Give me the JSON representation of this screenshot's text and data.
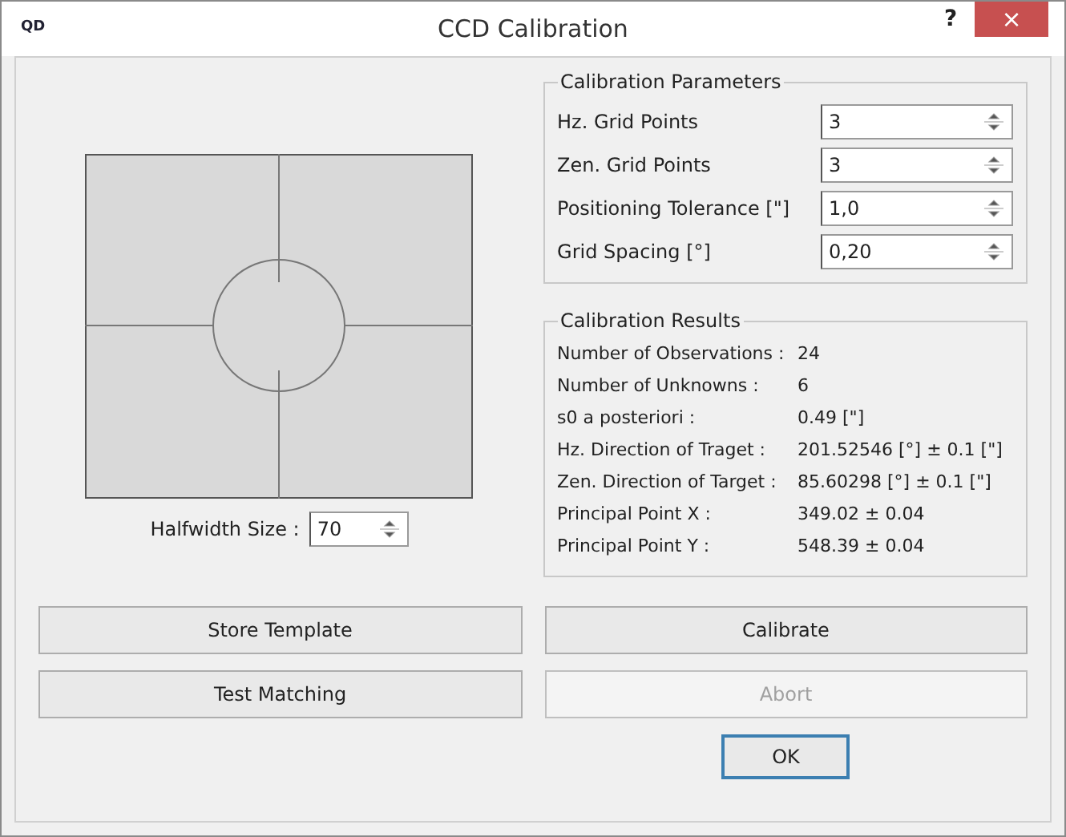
{
  "window": {
    "logo": "QD",
    "title": "CCD Calibration",
    "help": "?",
    "close": "×"
  },
  "preview": {
    "halfwidth": {
      "label": "Halfwidth Size :",
      "value": "70"
    }
  },
  "parameters": {
    "title": "Calibration Parameters",
    "fields": [
      {
        "label": "Hz. Grid Points",
        "value": "3"
      },
      {
        "label": "Zen. Grid Points",
        "value": "3"
      },
      {
        "label": "Positioning Tolerance [\"]",
        "value": "1,0"
      },
      {
        "label": "Grid Spacing [°]",
        "value": "0,20"
      }
    ]
  },
  "results": {
    "title": "Calibration Results",
    "rows": [
      {
        "label": "Number of Observations :",
        "value": "24"
      },
      {
        "label": "Number of Unknowns :",
        "value": "6"
      },
      {
        "label": "s0 a posteriori :",
        "value": "0.49 [\"]"
      },
      {
        "label": "Hz. Direction of Traget :",
        "value": "201.52546 [°] ± 0.1 [\"]"
      },
      {
        "label": "Zen. Direction of Target :",
        "value": "85.60298 [°] ± 0.1 [\"]"
      },
      {
        "label": "Principal Point X :",
        "value": "349.02 ± 0.04"
      },
      {
        "label": "Principal Point Y :",
        "value": "548.39 ± 0.04"
      }
    ]
  },
  "buttons": [
    {
      "label": "Store Template",
      "disabled": false
    },
    {
      "label": "Calibrate",
      "disabled": false
    },
    {
      "label": "Test Matching",
      "disabled": false
    },
    {
      "label": "Abort",
      "disabled": true
    }
  ],
  "ok_button": {
    "label": "OK"
  }
}
